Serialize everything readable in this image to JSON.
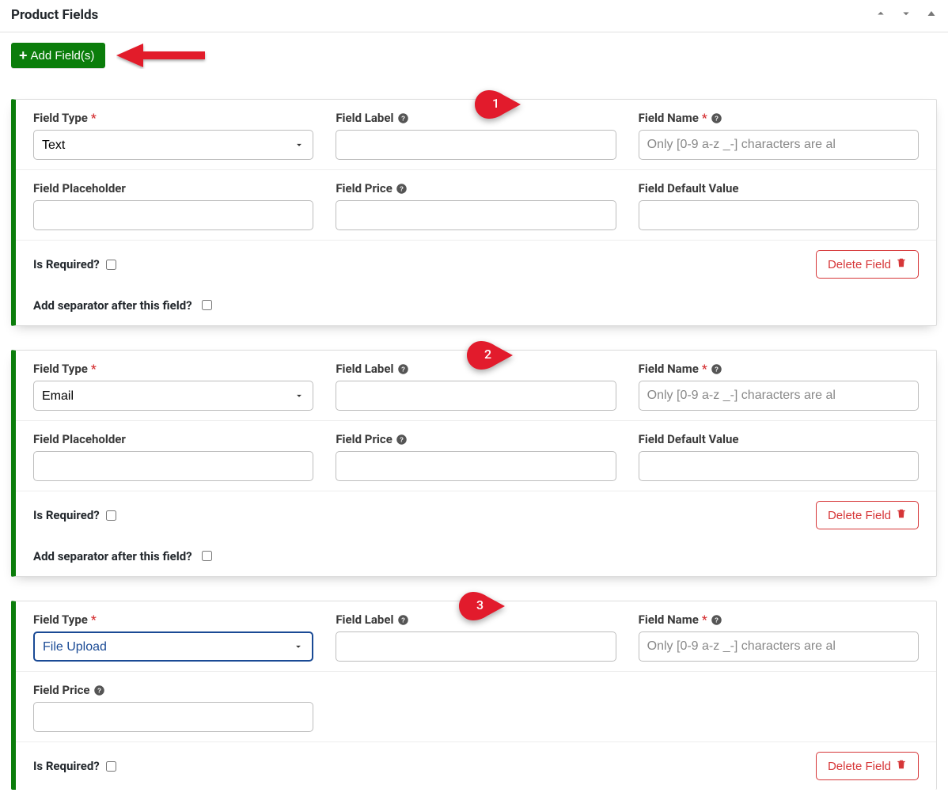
{
  "header": {
    "title": "Product Fields"
  },
  "toolbar": {
    "add_label": "Add Field(s)"
  },
  "labels": {
    "field_type": "Field Type",
    "field_label": "Field Label",
    "field_name": "Field Name",
    "field_placeholder": "Field Placeholder",
    "field_price": "Field Price",
    "field_default": "Field Default Value",
    "is_required": "Is Required?",
    "add_separator": "Add separator after this field?",
    "delete": "Delete Field"
  },
  "placeholders": {
    "field_name": "Only [0-9 a-z _-] characters are al"
  },
  "annotations": {
    "badge1": "1",
    "badge2": "2",
    "badge3": "3"
  },
  "cards": [
    {
      "type_value": "Text",
      "show_placeholder": true,
      "show_default": true,
      "price_in_row2": true,
      "select_focused": false
    },
    {
      "type_value": "Email",
      "show_placeholder": true,
      "show_default": true,
      "price_in_row2": true,
      "select_focused": false
    },
    {
      "type_value": "File Upload",
      "show_placeholder": false,
      "show_default": false,
      "price_in_row2": false,
      "select_focused": true
    }
  ]
}
